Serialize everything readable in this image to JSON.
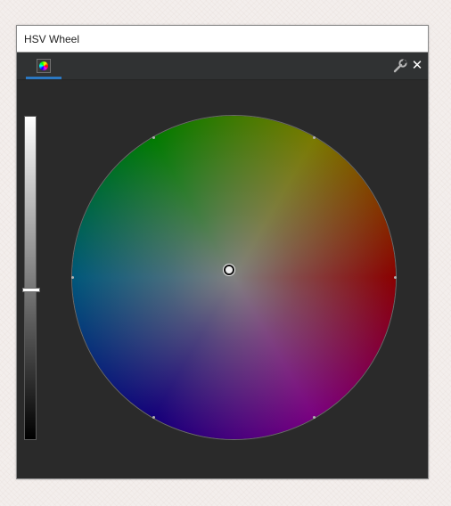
{
  "window": {
    "title": "HSV Wheel"
  },
  "tabs": [
    {
      "icon": "color-wheel-icon",
      "active": true
    }
  ],
  "toolbar": {
    "settings_icon": "wrench-icon",
    "close_label": "✕"
  },
  "value_slider": {
    "level": 0.46,
    "gradient_top": "#ffffff",
    "gradient_bottom": "#000000"
  },
  "color_wheel": {
    "hue_order": [
      "red",
      "magenta",
      "blue",
      "cyan",
      "green",
      "yellow"
    ],
    "selected_marker_near_center": true
  },
  "colors": {
    "panel_background": "#2a2a2a",
    "tab_bar": "#303233",
    "active_tab_accent": "#2b78c2",
    "title_bar": "#ffffff"
  }
}
